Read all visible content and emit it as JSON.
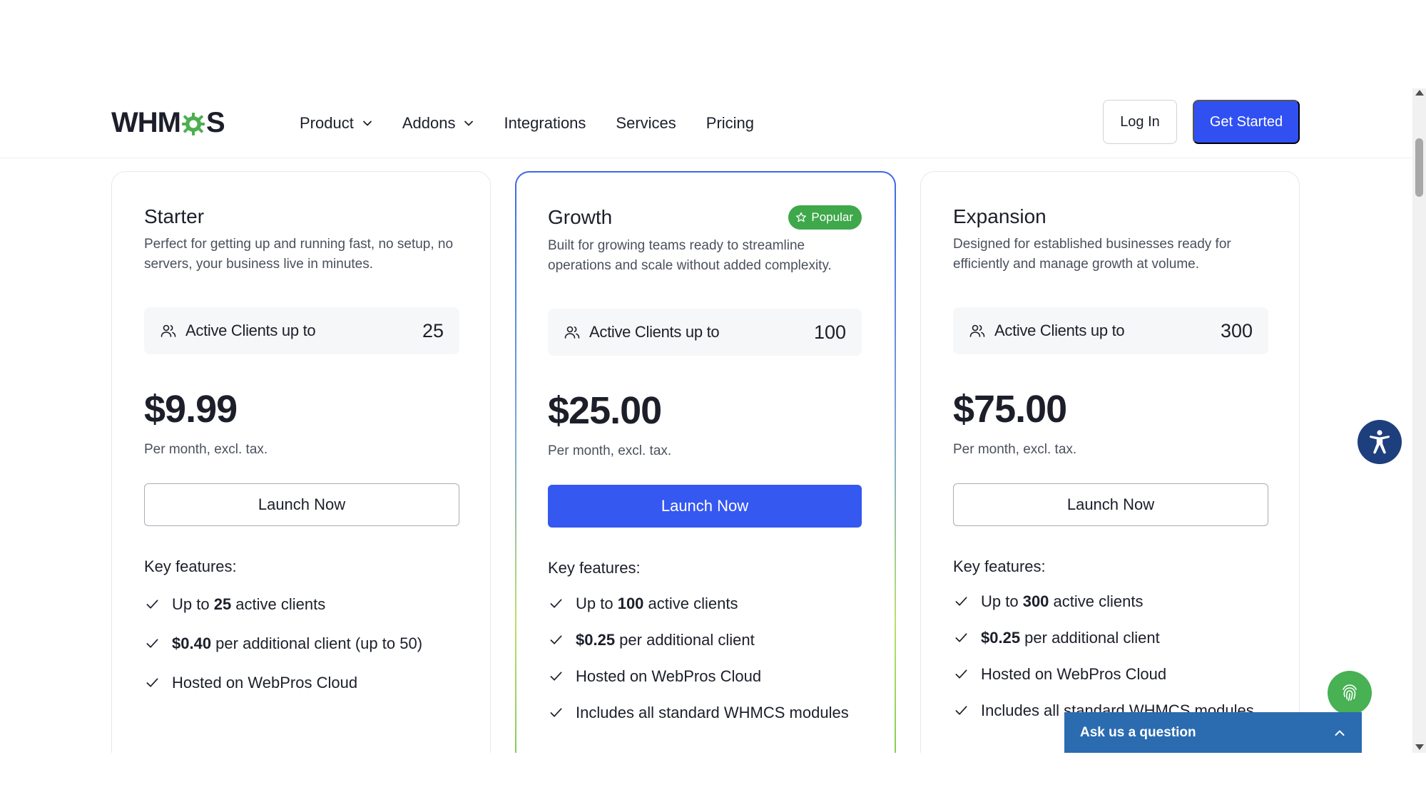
{
  "header": {
    "logo_text_start": "WHM",
    "logo_text_end": "S",
    "nav": [
      {
        "label": "Product",
        "dropdown": true
      },
      {
        "label": "Addons",
        "dropdown": true
      },
      {
        "label": "Integrations",
        "dropdown": false
      },
      {
        "label": "Services",
        "dropdown": false
      },
      {
        "label": "Pricing",
        "dropdown": false
      }
    ],
    "login_label": "Log In",
    "get_started_label": "Get Started"
  },
  "colors": {
    "primary_blue": "#3050f2",
    "popular_green": "#3ea84a",
    "accessibility_navy": "#1e3f7d",
    "chat_blue": "#2b6bb0"
  },
  "plans": [
    {
      "name": "Starter",
      "description": "Perfect for getting up and running fast, no setup, no servers, your business live in minutes.",
      "clients_label": "Active Clients up to",
      "clients_value": "25",
      "price": "$9.99",
      "per": "Per month, excl. tax.",
      "cta": "Launch Now",
      "key_features_label": "Key features:",
      "features": [
        {
          "pre": "Up to ",
          "bold": "25",
          "post": " active clients"
        },
        {
          "pre": "",
          "bold": "$0.40",
          "post": " per additional client (up to 50)"
        },
        {
          "pre": "Hosted on WebPros Cloud",
          "bold": "",
          "post": ""
        }
      ]
    },
    {
      "name": "Growth",
      "badge": "Popular",
      "description": "Built for growing teams ready to streamline operations and scale without added complexity.",
      "clients_label": "Active Clients up to",
      "clients_value": "100",
      "price": "$25.00",
      "per": "Per month, excl. tax.",
      "cta": "Launch Now",
      "key_features_label": "Key features:",
      "features": [
        {
          "pre": "Up to ",
          "bold": "100",
          "post": " active clients"
        },
        {
          "pre": "",
          "bold": "$0.25",
          "post": " per additional client"
        },
        {
          "pre": "Hosted on WebPros Cloud",
          "bold": "",
          "post": ""
        },
        {
          "pre": "Includes all standard WHMCS modules",
          "bold": "",
          "post": ""
        }
      ]
    },
    {
      "name": "Expansion",
      "description": "Designed for established businesses ready for efficiently and manage growth at volume.",
      "clients_label": "Active Clients up to",
      "clients_value": "300",
      "price": "$75.00",
      "per": "Per month, excl. tax.",
      "cta": "Launch Now",
      "key_features_label": "Key features:",
      "features": [
        {
          "pre": "Up to ",
          "bold": "300",
          "post": " active clients"
        },
        {
          "pre": "",
          "bold": "$0.25",
          "post": " per additional client"
        },
        {
          "pre": "Hosted on WebPros Cloud",
          "bold": "",
          "post": ""
        },
        {
          "pre": "Includes all standard WHMCS modules",
          "bold": "",
          "post": ""
        }
      ]
    }
  ],
  "chat": {
    "label": "Ask us a question"
  },
  "icons": {
    "accessibility": "accessibility-icon",
    "fingerprint": "fingerprint-icon",
    "check": "check-icon",
    "users": "users-icon",
    "star": "star-icon",
    "chevron": "chevron-down-icon"
  }
}
